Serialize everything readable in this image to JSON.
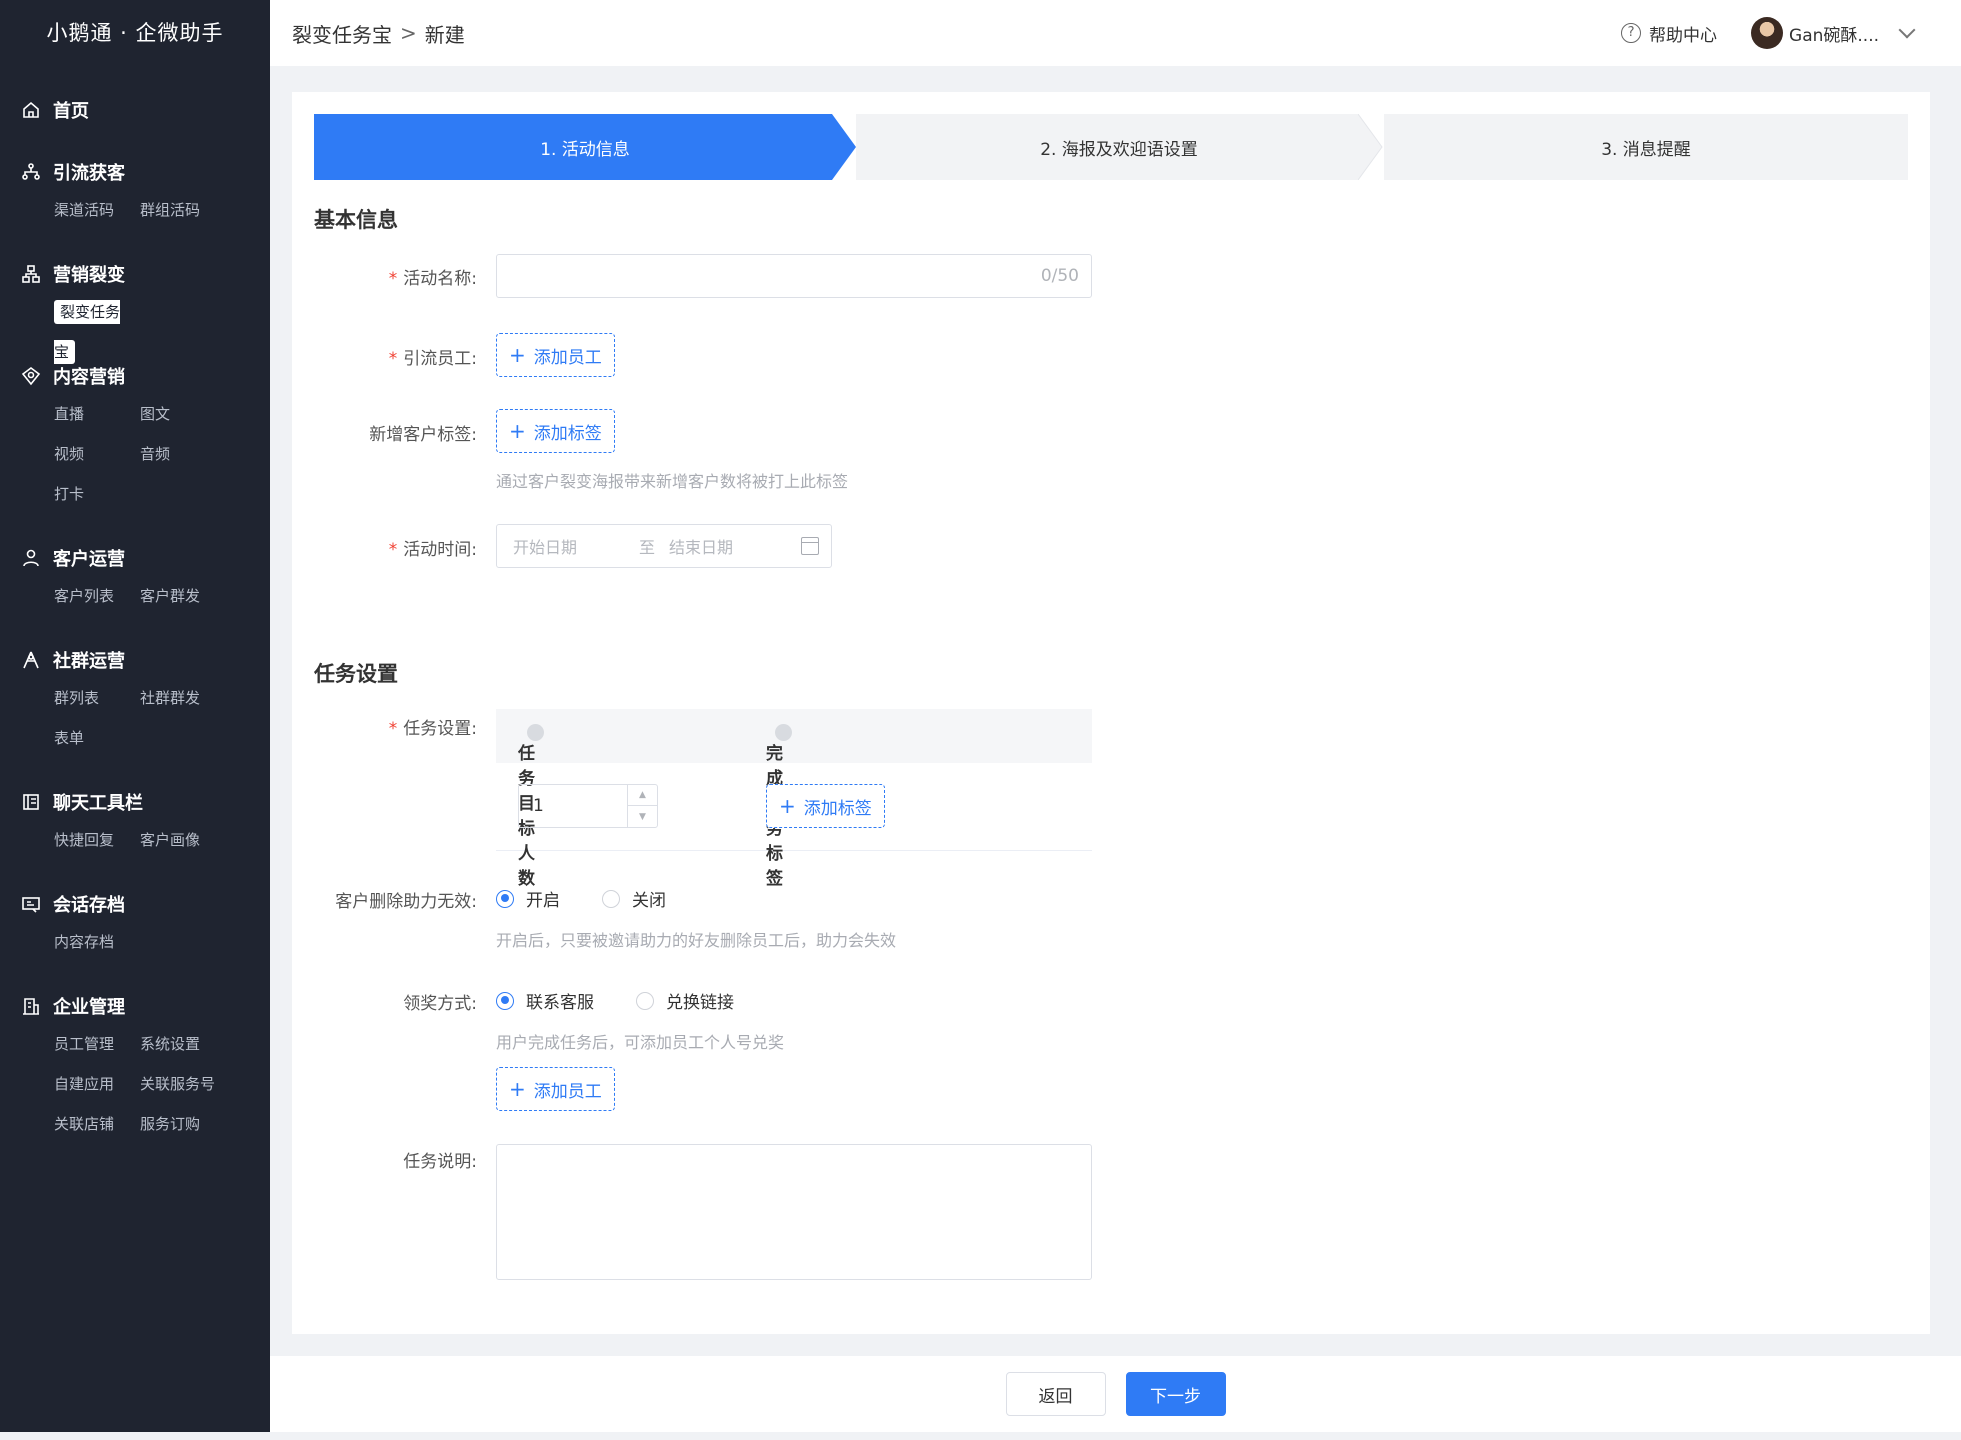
{
  "brand": "小鹅通 · 企微助手",
  "nav": [
    {
      "title": "首页",
      "icon": "home-icon",
      "subs": []
    },
    {
      "title": "引流获客",
      "icon": "network-icon",
      "subs": [
        "渠道活码",
        "群组活码"
      ]
    },
    {
      "title": "营销裂变",
      "icon": "org-chart-icon",
      "subs": [
        "裂变任务宝"
      ]
    },
    {
      "title": "内容营销",
      "icon": "content-icon",
      "subs": [
        "直播",
        "图文",
        "视频",
        "音频",
        "打卡"
      ]
    },
    {
      "title": "客户运营",
      "icon": "user-icon",
      "subs": [
        "客户列表",
        "客户群发"
      ]
    },
    {
      "title": "社群运营",
      "icon": "group-icon",
      "subs": [
        "群列表",
        "社群群发",
        "表单"
      ]
    },
    {
      "title": "聊天工具栏",
      "icon": "toolbar-icon",
      "subs": [
        "快捷回复",
        "客户画像"
      ]
    },
    {
      "title": "会话存档",
      "icon": "archive-icon",
      "subs": [
        "内容存档"
      ]
    },
    {
      "title": "企业管理",
      "icon": "building-icon",
      "subs": [
        "员工管理",
        "系统设置",
        "自建应用",
        "关联服务号",
        "关联店铺",
        "服务订购"
      ]
    }
  ],
  "header": {
    "breadcrumb_parent": "裂变任务宝",
    "breadcrumb_sep": ">",
    "breadcrumb_current": "新建",
    "help_label": "帮助中心",
    "user_name": "Gan碗酥...."
  },
  "steps": [
    "1. 活动信息",
    "2. 海报及欢迎语设置",
    "3. 消息提醒"
  ],
  "basic": {
    "section_title": "基本信息",
    "name_label": "活动名称:",
    "name_counter": "0/50",
    "staff_label": "引流员工:",
    "add_staff": "添加员工",
    "tag_label": "新增客户标签:",
    "add_tag": "添加标签",
    "tag_hint": "通过客户裂变海报带来新增客户数将被打上此标签",
    "time_label": "活动时间:",
    "start_placeholder": "开始日期",
    "range_sep": "至",
    "end_placeholder": "结束日期"
  },
  "task": {
    "section_title": "任务设置",
    "task_label": "任务设置:",
    "col_target": "任务目标人数",
    "col_tag": "完成任务标签",
    "target_value": "1",
    "add_tag": "添加标签",
    "delete_label": "客户删除助力无效:",
    "delete_on": "开启",
    "delete_off": "关闭",
    "delete_hint": "开启后，只要被邀请助力的好友删除员工后，助力会失效",
    "reward_label": "领奖方式:",
    "reward_service": "联系客服",
    "reward_link": "兑换链接",
    "reward_hint": "用户完成任务后，可添加员工个人号兑奖",
    "add_staff": "添加员工",
    "desc_label": "任务说明:"
  },
  "footer": {
    "back": "返回",
    "next": "下一步"
  },
  "colors": {
    "primary": "#2f7bf5",
    "sidebar": "#1f2430",
    "required": "#f04134"
  }
}
